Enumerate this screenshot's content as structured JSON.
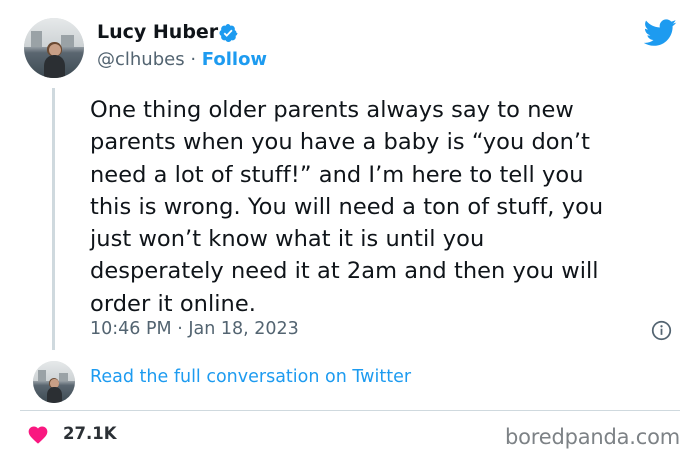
{
  "author": {
    "name": "Lucy Huber",
    "handle": "@clhubes",
    "separator": "·",
    "follow_label": "Follow",
    "verified": true
  },
  "tweet": {
    "text": "One thing older parents always say to new parents when you have a baby is “you don’t need a lot of stuff!” and I’m here to tell you this is wrong. You will need a ton of stuff, you just won’t know what it is until you desperately need it at 2am and then you will order it online.",
    "lines": [
      "One thing older parents always say to new",
      "parents when you have a baby is “you don’t",
      "need a lot of stuff!” and I’m here to tell you",
      "this is wrong. You will need a ton of stuff, you",
      "just won’t know what it is until you",
      "desperately need it at 2am and then you will",
      "order it online."
    ],
    "timestamp": "10:46 PM · Jan 18, 2023"
  },
  "conversation_link": "Read the full conversation on Twitter",
  "likes": "27.1K",
  "watermark": "boredpanda.com",
  "icons": {
    "brand": "twitter-bird-icon",
    "verified": "verified-badge-icon",
    "info": "info-icon",
    "like": "heart-icon"
  },
  "colors": {
    "accent": "#1d9bf0",
    "heart": "#f91880",
    "text": "#0f1419",
    "secondary": "#536471"
  }
}
